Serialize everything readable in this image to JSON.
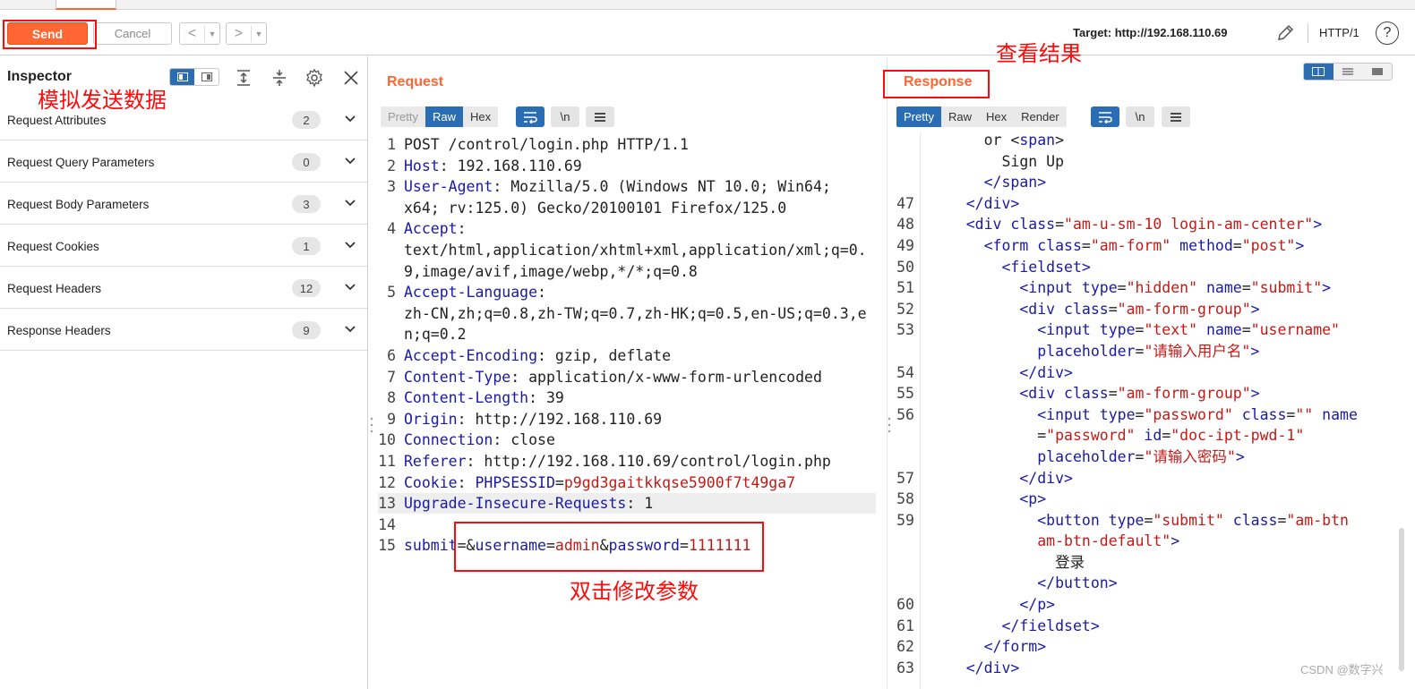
{
  "toolbar": {
    "send_label": "Send",
    "cancel_label": "Cancel",
    "back_label": "<",
    "forward_label": ">",
    "target_label": "Target: http://192.168.110.69",
    "protocol": "HTTP/1",
    "help": "?"
  },
  "inspector": {
    "title": "Inspector",
    "rows": [
      {
        "label": "Request Attributes",
        "count": "2"
      },
      {
        "label": "Request Query Parameters",
        "count": "0"
      },
      {
        "label": "Request Body Parameters",
        "count": "3"
      },
      {
        "label": "Request Cookies",
        "count": "1"
      },
      {
        "label": "Request Headers",
        "count": "12"
      },
      {
        "label": "Response Headers",
        "count": "9"
      }
    ]
  },
  "request": {
    "title": "Request",
    "tabs": {
      "pretty": "Pretty",
      "raw": "Raw",
      "hex": "Hex"
    },
    "newline_btn": "\\n",
    "line_numbers": [
      "1",
      "2",
      "3",
      "",
      "4",
      "",
      "",
      "5",
      "",
      "",
      "6",
      "7",
      "8",
      "9",
      "10",
      "11",
      "12",
      "13",
      "14",
      "15"
    ],
    "lines": {
      "l1": "POST /control/login.php HTTP/1.1",
      "l2k": "Host",
      "l2v": ": 192.168.110.69",
      "l3k": "User-Agent",
      "l3v": ": Mozilla/5.0 (Windows NT 10.0; Win64;",
      "l3c": "x64; rv:125.0) Gecko/20100101 Firefox/125.0",
      "l4k": "Accept",
      "l4v": ":",
      "l4c1": "text/html,application/xhtml+xml,application/xml;q=0.",
      "l4c2": "9,image/avif,image/webp,*/*;q=0.8",
      "l5k": "Accept-Language",
      "l5v": ":",
      "l5c1": "zh-CN,zh;q=0.8,zh-TW;q=0.7,zh-HK;q=0.5,en-US;q=0.3,e",
      "l5c2": "n;q=0.2",
      "l6k": "Accept-Encoding",
      "l6v": ": gzip, deflate",
      "l7k": "Content-Type",
      "l7v": ": application/x-www-form-urlencoded",
      "l8k": "Content-Length",
      "l8v": ": 39",
      "l9k": "Origin",
      "l9v": ": http://192.168.110.69",
      "l10k": "Connection",
      "l10v": ": close",
      "l11k": "Referer",
      "l11v": ": http://192.168.110.69/control/login.php",
      "l12k": "Cookie",
      "l12sep": ": ",
      "l12n": "PHPSESSID",
      "l12eq": "=",
      "l12val": "p9gd3gaitkkqse5900f7t49ga7",
      "l13k": "Upgrade-Insecure-Requests",
      "l13v": ": 1",
      "b1k": "submit",
      "b1e": "=&",
      "b2k": "username",
      "b2e": "=",
      "b2v": "admin",
      "b2a": "&",
      "b3k": "password",
      "b3e": "=",
      "b3v": "1111111"
    }
  },
  "response": {
    "title": "Response",
    "tabs": {
      "pretty": "Pretty",
      "raw": "Raw",
      "hex": "Hex",
      "render": "Render"
    },
    "newline_btn": "\\n",
    "line_numbers": [
      "",
      "",
      "",
      "47",
      "48",
      "49",
      "50",
      "51",
      "52",
      "53",
      "",
      "54",
      "55",
      "56",
      "",
      "",
      "57",
      "58",
      "59",
      "",
      "",
      "",
      "60",
      "61",
      "62",
      "63"
    ],
    "lines": {
      "r0": "or <",
      "r0t": "span",
      "r0e": ">",
      "r1": "Sign Up",
      "r2t": "</span>",
      "r47": "</div>",
      "r48t": "<div",
      "r48a": " class",
      "r48e": "=",
      "r48v": "\"am-u-sm-10 login-am-center\"",
      "r48c": ">",
      "r49t": "<form",
      "r49a": " class",
      "r49v": "\"am-form\"",
      "r49a2": " method",
      "r49v2": "\"post\"",
      "r50": "<fieldset>",
      "r51t": "<input",
      "r51a": " type",
      "r51v": "\"hidden\"",
      "r51a2": " name",
      "r51v2": "\"submit\"",
      "r52t": "<div",
      "r52a": " class",
      "r52v": "\"am-form-group\"",
      "r53t": "<input",
      "r53a": " type",
      "r53v": "\"text\"",
      "r53a2": " name",
      "r53v2": "\"username\"",
      "r53ca": "placeholder",
      "r53cv": "\"请输入用户名\"",
      "r54": "</div>",
      "r55t": "<div",
      "r55a": " class",
      "r55v": "\"am-form-group\"",
      "r56t": "<input",
      "r56a": " type",
      "r56v": "\"password\"",
      "r56a2": " class",
      "r56v2": "\"\"",
      "r56a3": " name",
      "r56c1e": "=",
      "r56c1v": "\"password\"",
      "r56c1a": " id",
      "r56c1v2": "\"doc-ipt-pwd-1\"",
      "r56c2a": "placeholder",
      "r56c2v": "\"请输入密码\"",
      "r57": "</div>",
      "r58": "<p>",
      "r59t": "<button",
      "r59a": " type",
      "r59v": "\"submit\"",
      "r59a2": " class",
      "r59v2": "\"am-btn",
      "r59c1v": "am-btn-default\"",
      "r59c2": "登录",
      "r59c3": "</button>",
      "r60": "</p>",
      "r61": "</fieldset>",
      "r62": "</form>",
      "r63": "</div>"
    }
  },
  "annotations": {
    "simulate_send": "模拟发送数据",
    "view_result": "查看结果",
    "double_click_edit": "双击修改参数"
  },
  "watermark": "CSDN @数字兴",
  "colors": {
    "accent": "#ff6633",
    "selected": "#2b6db5",
    "annotation": "#ff0a0a"
  }
}
